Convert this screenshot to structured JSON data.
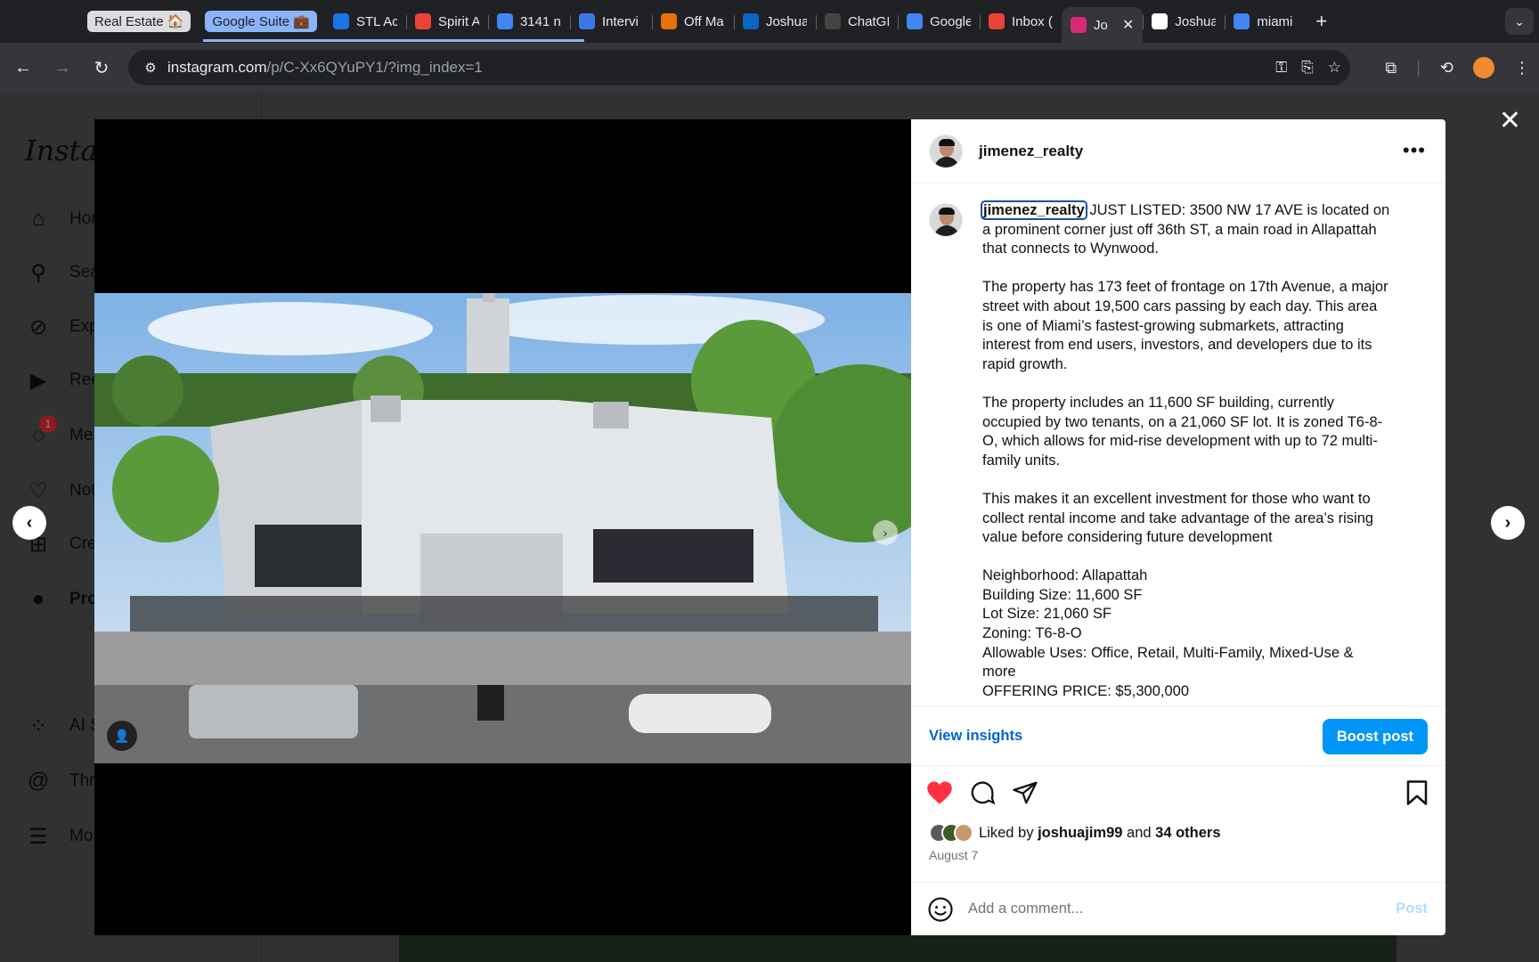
{
  "browser": {
    "tab_groups": [
      {
        "label": "Real Estate 🏠"
      },
      {
        "label": "Google Suite 💼"
      }
    ],
    "tabs": [
      {
        "label": "STL Ac",
        "icon": "calendar-icon",
        "color": "#1a73e8"
      },
      {
        "label": "Spirit A",
        "icon": "gmail-icon",
        "color": "#ea4335"
      },
      {
        "label": "3141 n",
        "icon": "google-icon",
        "color": "#4285f4"
      },
      {
        "label": "Intervi",
        "icon": "globe-icon",
        "color": "#3b78e7"
      },
      {
        "label": "Off Ma",
        "icon": "cloud-icon",
        "color": "#e8710a"
      },
      {
        "label": "Joshua",
        "icon": "linkedin-icon",
        "color": "#0a66c2"
      },
      {
        "label": "ChatGI",
        "icon": "chatgpt-icon",
        "color": "#444"
      },
      {
        "label": "Google",
        "icon": "globe-icon",
        "color": "#4285f4"
      },
      {
        "label": "Inbox (",
        "icon": "gmail-icon",
        "color": "#ea4335"
      },
      {
        "label": "Jo",
        "icon": "instagram-icon",
        "color": "#d62976",
        "active": true
      },
      {
        "label": "Joshua",
        "icon": "doc-icon",
        "color": "#ffffff"
      },
      {
        "label": "miami",
        "icon": "google-icon",
        "color": "#4285f4"
      }
    ],
    "url_host": "instagram.com",
    "url_path": "/p/C-Xx6QYuPY1/?img_index=1"
  },
  "instagram": {
    "logo": "Instag",
    "nav": [
      {
        "label": "Hor",
        "icon": "home-icon"
      },
      {
        "label": "Sea",
        "icon": "search-icon"
      },
      {
        "label": "Exp",
        "icon": "compass-icon"
      },
      {
        "label": "Ree",
        "icon": "reels-icon"
      },
      {
        "label": "Me",
        "icon": "messenger-icon",
        "badge": "1"
      },
      {
        "label": "Not",
        "icon": "heart-icon"
      },
      {
        "label": "Cre",
        "icon": "plus-square-icon"
      },
      {
        "label": "Pro",
        "icon": "avatar-icon"
      },
      {
        "label": "AI S",
        "icon": "ai-studio-icon"
      },
      {
        "label": "Thr",
        "icon": "threads-icon"
      },
      {
        "label": "Mo",
        "icon": "menu-icon"
      }
    ]
  },
  "post": {
    "username": "jimenez_realty",
    "caption_user": "jimenez_realty",
    "caption_lines_p1": [
      " JUST LISTED: 3500 NW 17 AVE is located on",
      "a prominent corner just off 36th ST, a main road in Allapattah",
      "that connects to Wynwood."
    ],
    "caption_p2": [
      "The property has 173 feet of frontage on 17th Avenue, a major",
      "street with about 19,500 cars passing by each day. This area",
      "is one of Miami’s fastest-growing submarkets, attracting",
      "interest from end users, investors, and developers due to its",
      "rapid growth."
    ],
    "caption_p3": [
      "The property includes an 11,600 SF building, currently",
      "occupied by two tenants, on a 21,060 SF lot. It is zoned T6-8-",
      "O, which allows for mid-rise development with up to 72 multi-",
      "family units."
    ],
    "caption_p4": [
      "This makes it an excellent investment for those who want to",
      "collect rental income and take advantage of the area’s rising",
      "value before considering future development"
    ],
    "caption_p5": [
      "Neighborhood: Allapattah",
      "Building Size: 11,600 SF",
      "Lot Size: 21,060 SF",
      "Zoning: T6-8-O",
      "Allowable Uses: Office, Retail, Multi-Family, Mixed-Use &",
      "more",
      "OFFERING PRICE: $5,300,000"
    ],
    "view_insights": "View insights",
    "boost": "Boost post",
    "liked_prefix": "Liked by",
    "liked_user": "joshuajim99",
    "liked_and": "and",
    "liked_others": "34 others",
    "date": "August 7",
    "comment_placeholder": "Add a comment...",
    "post_label": "Post",
    "like_color": "#ff3040"
  }
}
